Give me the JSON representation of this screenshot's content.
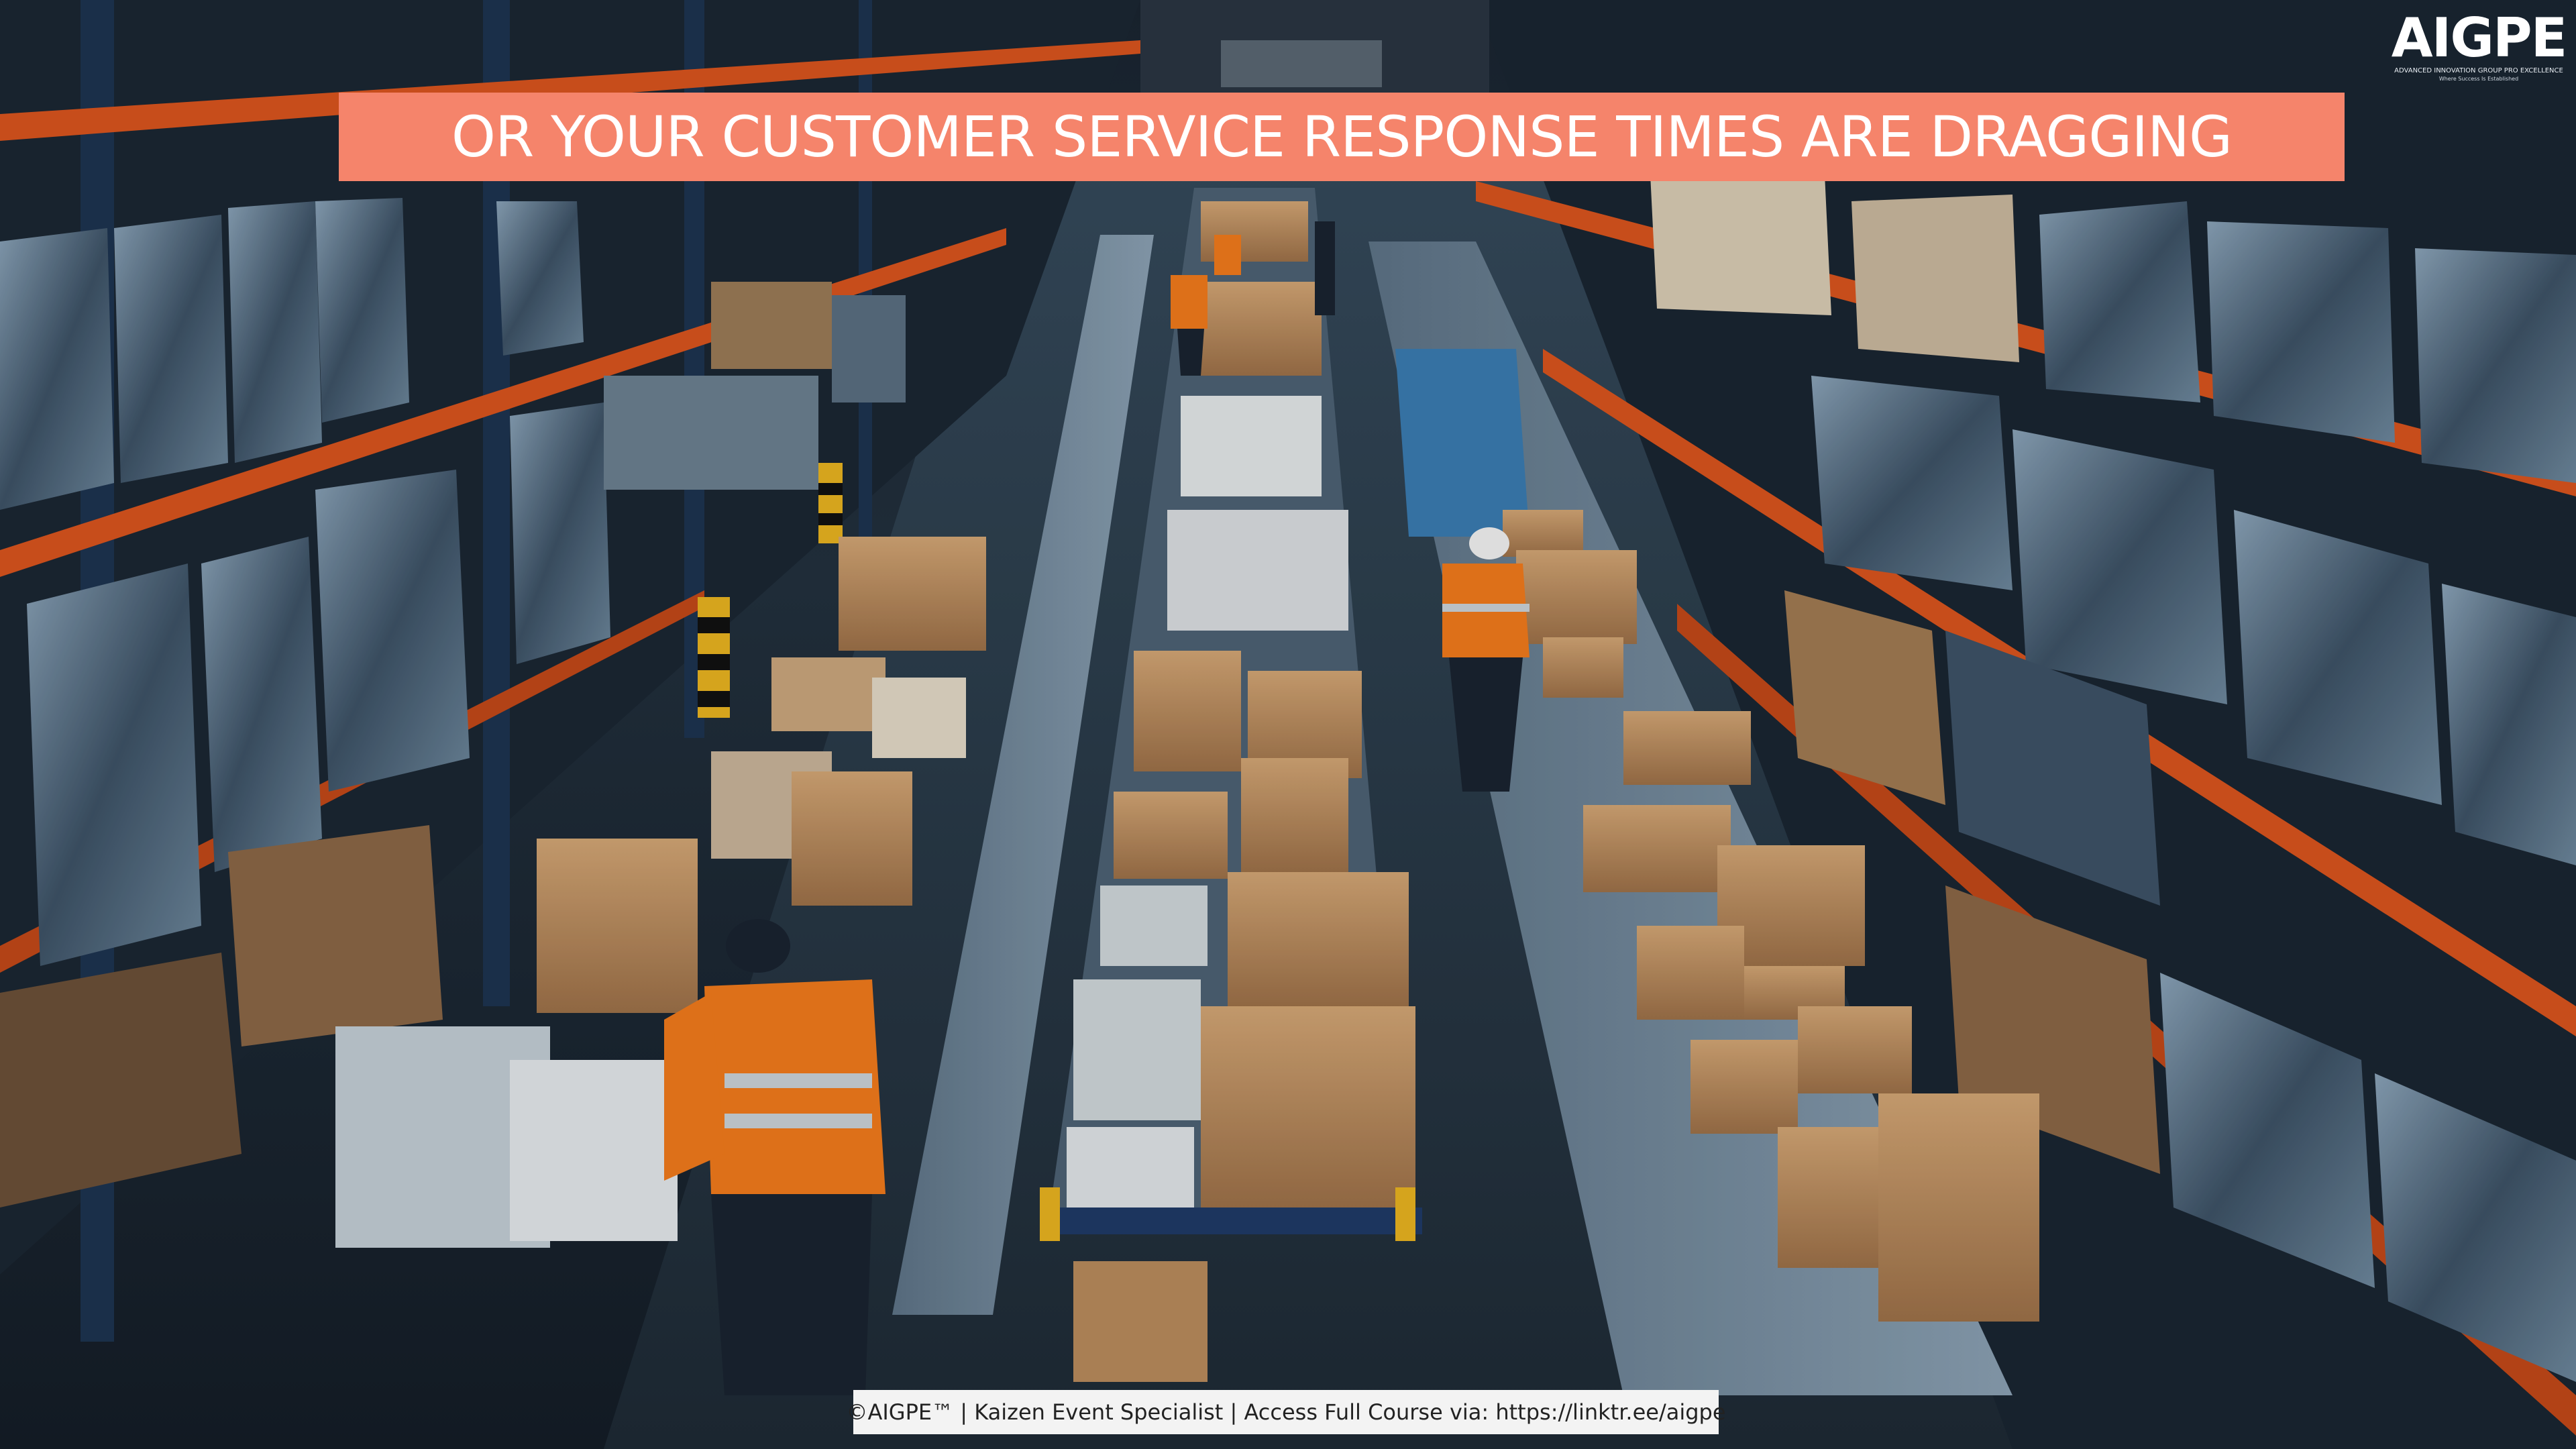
{
  "banner": {
    "text": "OR YOUR CUSTOMER SERVICE RESPONSE TIMES ARE DRAGGING",
    "color": "#f5846b"
  },
  "logo": {
    "mark": "AIGPE",
    "tagline": "ADVANCED INNOVATION GROUP PRO EXCELLENCE",
    "subtagline": "Where Success Is Established"
  },
  "footer": {
    "text": "©AIGPE™ | Kaizen Event Specialist | Access Full Course via: https://linktr.ee/aigpe"
  },
  "scene": {
    "subject": "warehouse aisles with conveyor lines of cardboard boxes and workers in orange safety vests",
    "accent_colors": {
      "rack_orange": "#d8541e",
      "vest_orange": "#f07a1c",
      "box_brown": "#b88a5c",
      "floor": "#2b3a48"
    }
  }
}
